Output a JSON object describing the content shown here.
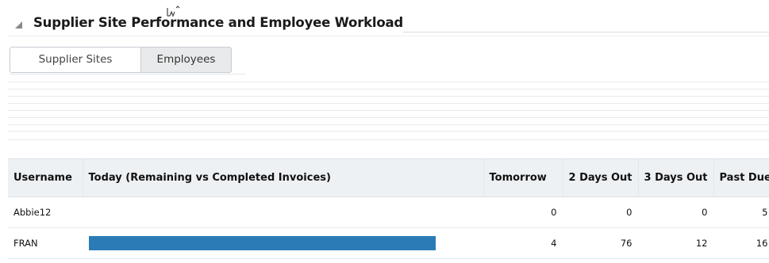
{
  "section": {
    "title": "Supplier Site Performance and Employee Workload"
  },
  "tabs": [
    {
      "label": "Supplier Sites",
      "selected": false
    },
    {
      "label": "Employees",
      "selected": true
    }
  ],
  "table": {
    "columns": [
      "Username",
      "Today (Remaining vs Completed Invoices)",
      "Tomorrow",
      "2 Days Out",
      "3 Days Out",
      "Past Due"
    ],
    "rows": [
      {
        "username": "Abbie12",
        "today_fraction": 0,
        "tomorrow": "0",
        "two_days": "0",
        "three_days": "0",
        "past_due": "5"
      },
      {
        "username": "FRAN",
        "today_fraction": 0.88,
        "tomorrow": "4",
        "two_days": "76",
        "three_days": "12",
        "past_due": "16"
      }
    ]
  },
  "colors": {
    "bar": "#2b7bb6",
    "header_bg": "#eef1f4"
  }
}
